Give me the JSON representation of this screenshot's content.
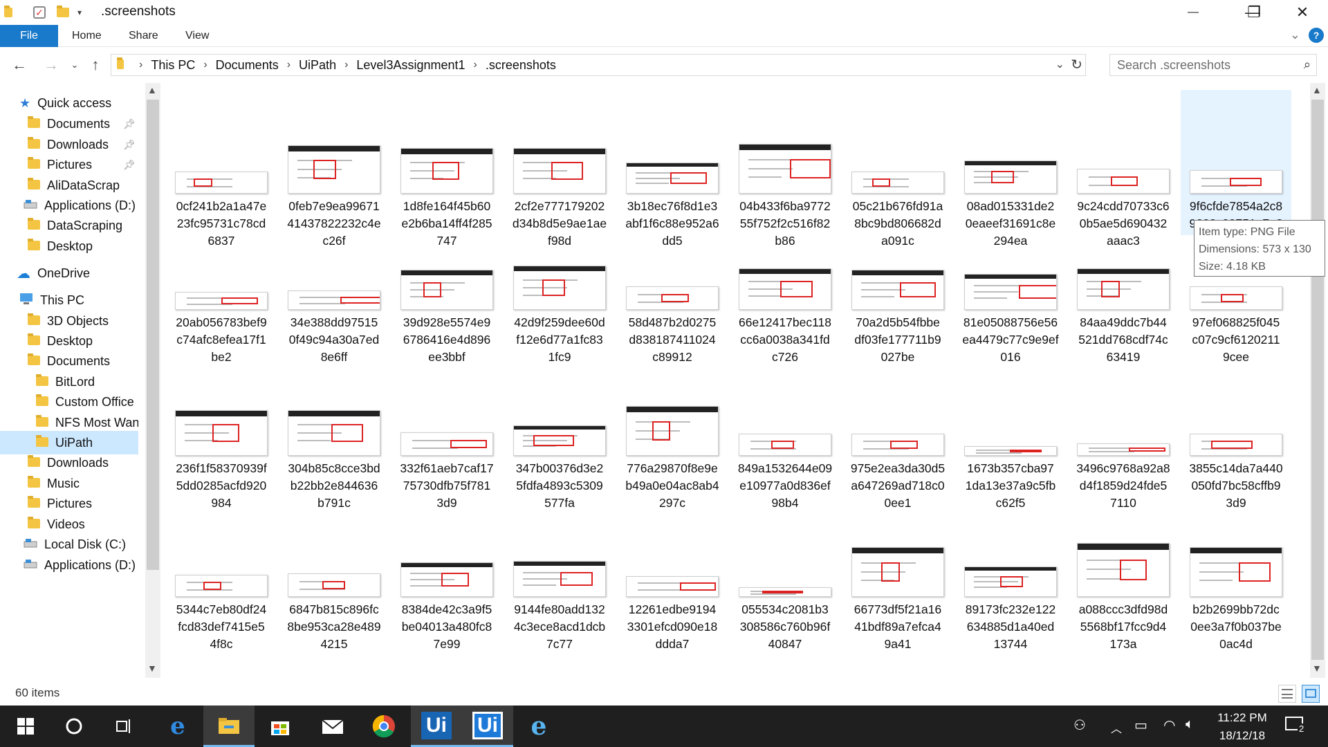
{
  "window": {
    "title": ".screenshots",
    "minimize_glyph": "—",
    "maximize_glyph": "❐",
    "close_glyph": "✕"
  },
  "ribbon": {
    "tabs": [
      "File",
      "Home",
      "Share",
      "View"
    ],
    "help_glyph": "?"
  },
  "address": {
    "crumbs": [
      "This PC",
      "Documents",
      "UiPath",
      "Level3Assignment1",
      ".screenshots"
    ],
    "search_placeholder": "Search .screenshots"
  },
  "nav": {
    "items": [
      {
        "label": "Quick access",
        "icon": "star-icon",
        "pinned": false
      },
      {
        "label": "Documents",
        "icon": "folder-icon",
        "pinned": true
      },
      {
        "label": "Downloads",
        "icon": "download-folder-icon",
        "pinned": true
      },
      {
        "label": "Pictures",
        "icon": "folder-icon",
        "pinned": true
      },
      {
        "label": "AliDataScrap",
        "icon": "folder-icon",
        "pinned": false
      },
      {
        "label": "Applications (D:)",
        "icon": "drive-icon",
        "pinned": false
      },
      {
        "label": "DataScraping",
        "icon": "folder-icon",
        "pinned": false
      },
      {
        "label": "Desktop",
        "icon": "folder-icon",
        "pinned": false
      },
      {
        "label": "OneDrive",
        "icon": "cloud-icon",
        "pinned": false
      },
      {
        "label": "This PC",
        "icon": "computer-icon",
        "pinned": false
      },
      {
        "label": "3D Objects",
        "icon": "folder-icon",
        "pinned": false
      },
      {
        "label": "Desktop",
        "icon": "folder-icon",
        "pinned": false
      },
      {
        "label": "Documents",
        "icon": "folder-icon",
        "pinned": false
      },
      {
        "label": "BitLord",
        "icon": "folder-icon",
        "pinned": false
      },
      {
        "label": "Custom Office",
        "icon": "folder-icon",
        "pinned": false
      },
      {
        "label": "NFS Most Wan",
        "icon": "folder-icon",
        "pinned": false
      },
      {
        "label": "UiPath",
        "icon": "folder-icon",
        "pinned": false,
        "selected": true
      },
      {
        "label": "Downloads",
        "icon": "download-folder-icon",
        "pinned": false
      },
      {
        "label": "Music",
        "icon": "music-folder-icon",
        "pinned": false
      },
      {
        "label": "Pictures",
        "icon": "folder-icon",
        "pinned": false
      },
      {
        "label": "Videos",
        "icon": "video-folder-icon",
        "pinned": false
      },
      {
        "label": "Local Disk (C:)",
        "icon": "drive-icon",
        "pinned": false
      },
      {
        "label": "Applications (D:)",
        "icon": "drive-icon",
        "pinned": false
      }
    ]
  },
  "files": [
    [
      "0cf241b2a1a47e",
      "23fc95731c78cd",
      "6837"
    ],
    [
      "0feb7e9ea99671",
      "41437822232c4e",
      "c26f"
    ],
    [
      "1d8fe164f45b60",
      "e2b6ba14ff4f285",
      "747"
    ],
    [
      "2cf2e777179202",
      "d34b8d5e9ae1ae",
      "f98d"
    ],
    [
      "3b18ec76f8d1e3",
      "abf1f6c88e952a6",
      "dd5"
    ],
    [
      "04b433f6ba9772",
      "55f752f2c516f82",
      "b86"
    ],
    [
      "05c21b676fd91a",
      "8bc9bd806682d",
      "a091c"
    ],
    [
      "08ad015331de2",
      "0eaeef31691c8e",
      "294ea"
    ],
    [
      "9c24cdd70733c6",
      "0b5ae5d690432",
      "aaac3"
    ],
    [
      "9f6cfde7854a2c8",
      "9602c29751a7a8",
      ""
    ],
    [
      "20ab056783bef9",
      "c74afc8efea17f1",
      "be2"
    ],
    [
      "34e388dd97515",
      "0f49c94a30a7ed",
      "8e6ff"
    ],
    [
      "39d928e5574e9",
      "6786416e4d896",
      "ee3bbf"
    ],
    [
      "42d9f259dee60d",
      "f12e6d77a1fc83",
      "1fc9"
    ],
    [
      "58d487b2d0275",
      "d838187411024",
      "c89912"
    ],
    [
      "66e12417bec118",
      "cc6a0038a341fd",
      "c726"
    ],
    [
      "70a2d5b54fbbe",
      "df03fe177711b9",
      "027be"
    ],
    [
      "81e05088756e56",
      "ea4479c77c9e9ef",
      "016"
    ],
    [
      "84aa49ddc7b44",
      "521dd768cdf74c",
      "63419"
    ],
    [
      "97ef068825f045",
      "c07c9cf6120211",
      "9cee"
    ],
    [
      "236f1f58370939f",
      "5dd0285acfd920",
      "984"
    ],
    [
      "304b85c8cce3bd",
      "b22bb2e844636",
      "b791c"
    ],
    [
      "332f61aeb7caf17",
      "75730dfb75f781",
      "3d9"
    ],
    [
      "347b00376d3e2",
      "5fdfa4893c5309",
      "577fa"
    ],
    [
      "776a29870f8e9e",
      "b49a0e04ac8ab4",
      "297c"
    ],
    [
      "849a1532644e09",
      "e10977a0d836ef",
      "98b4"
    ],
    [
      "975e2ea3da30d5",
      "a647269ad718c0",
      "0ee1"
    ],
    [
      "1673b357cba97",
      "1da13e37a9c5fb",
      "c62f5"
    ],
    [
      "3496c9768a92a8",
      "d4f1859d24fde5",
      "7110"
    ],
    [
      "3855c14da7a440",
      "050fd7bc58cffb9",
      "3d9"
    ],
    [
      "5344c7eb80df24",
      "fcd83def7415e5",
      "4f8c"
    ],
    [
      "6847b815c896fc",
      "8be953ca28e489",
      "4215"
    ],
    [
      "8384de42c3a9f5",
      "be04013a480fc8",
      "7e99"
    ],
    [
      "9144fe80add132",
      "4c3ece8acd1dcb",
      "7c77"
    ],
    [
      "12261edbe9194",
      "3301efcd090e18",
      "ddda7"
    ],
    [
      "055534c2081b3",
      "308586c760b96f",
      "40847"
    ],
    [
      "66773df5f21a16",
      "41bdf89a7efca4",
      "9a41"
    ],
    [
      "89173fc232e122",
      "634885d1a40ed",
      "13744"
    ],
    [
      "a088ccc3dfd98d",
      "5568bf17fcc9d4",
      "173a"
    ],
    [
      "b2b2699bb72dc",
      "0ee3a7f0b037be",
      "0ac4d"
    ]
  ],
  "tooltip": {
    "type": "Item type: PNG File",
    "dimensions": "Dimensions: 573 x 130",
    "size": "Size: 4.18 KB"
  },
  "status": {
    "item_count": "60 items"
  },
  "taskbar": {
    "time": "11:22 PM",
    "date": "18/12/18",
    "notification_count": "2",
    "ui_label": "Ui"
  }
}
